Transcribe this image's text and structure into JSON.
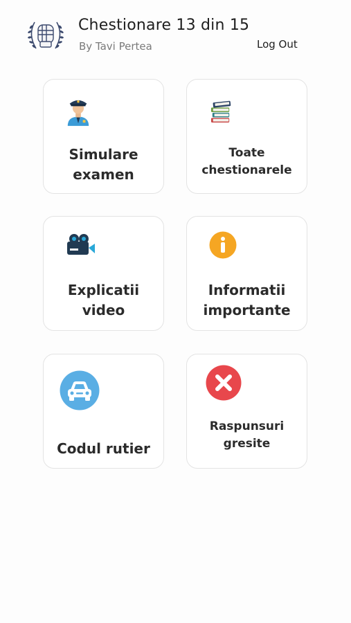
{
  "header": {
    "title": "Chestionare 13 din 15",
    "subtitle": "By Tavi Pertea",
    "logout_label": "Log Out",
    "logo_icon": "fist-laurel-logo-icon"
  },
  "menu": [
    {
      "label": "Simulare\nexamen",
      "icon": "police-officer-icon"
    },
    {
      "label": "Toate\nchestionarele",
      "icon": "books-stack-icon"
    },
    {
      "label": "Explicatii\nvideo",
      "icon": "video-camera-icon"
    },
    {
      "label": "Informatii\nimportante",
      "icon": "info-icon"
    },
    {
      "label": "Codul rutier",
      "icon": "car-icon"
    },
    {
      "label": "Raspunsuri\ngresite",
      "icon": "wrong-x-icon"
    }
  ],
  "colors": {
    "info": "#f5a623",
    "car": "#5aaee4",
    "wrong": "#e8474c",
    "camera": "#213a52",
    "camera_accent": "#2aa8d8"
  }
}
